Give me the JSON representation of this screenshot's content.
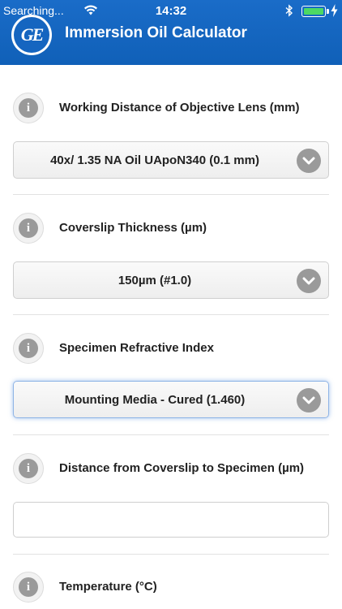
{
  "status_bar": {
    "carrier": "Searching...",
    "time": "14:32"
  },
  "header": {
    "logo_text": "GE",
    "title": "Immersion Oil Calculator"
  },
  "sections": [
    {
      "label": "Working Distance of Objective Lens (mm)",
      "type": "select",
      "value": "40x/ 1.35 NA Oil UApoN340 (0.1 mm)"
    },
    {
      "label": "Coverslip Thickness (µm)",
      "type": "select",
      "value": "150µm (#1.0)"
    },
    {
      "label": "Specimen Refractive Index",
      "type": "select",
      "value": "Mounting Media - Cured (1.460)"
    },
    {
      "label": "Distance from Coverslip to Specimen (µm)",
      "type": "input",
      "value": "",
      "placeholder": ""
    },
    {
      "label": "Temperature (°C)",
      "type": "input"
    }
  ],
  "icons": {
    "info": "info-icon",
    "chevron": "chevron-down-icon"
  },
  "colors": {
    "header_bg": "#1565c0",
    "battery": "#4cd964",
    "icon_gray": "#9a9a9a"
  }
}
